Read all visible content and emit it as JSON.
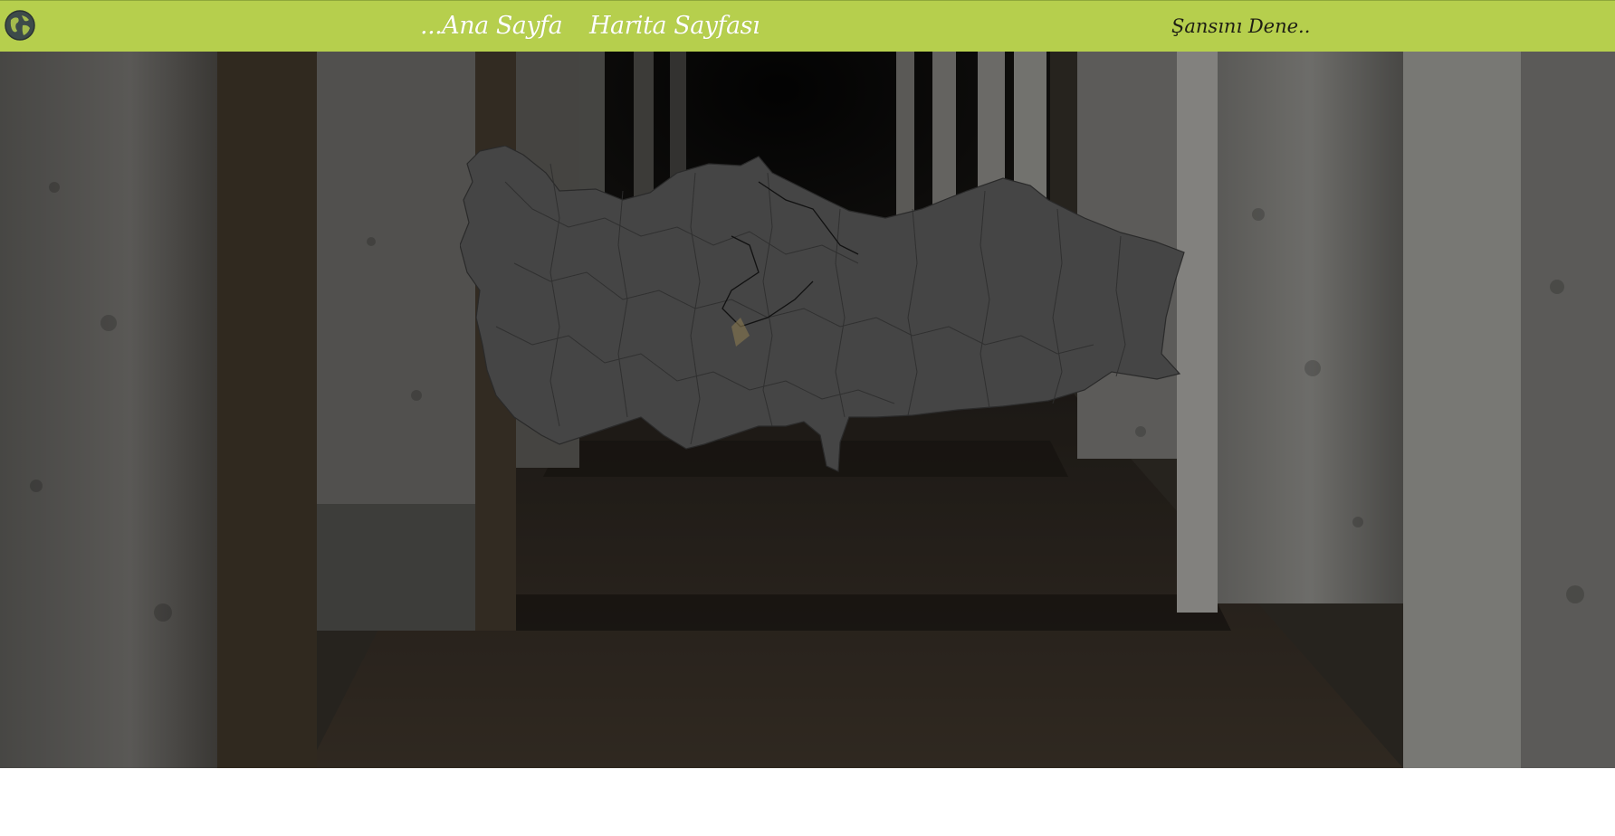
{
  "nav": {
    "logo_icon": "globe-icon",
    "home_label": "...Ana Sayfa",
    "map_label": "Harita Sayfası",
    "luck_label": "Şansını Dene.."
  },
  "colors": {
    "navbar_bg": "#b6cf4d",
    "nav_text": "#ffffff",
    "luck_text": "#1e1e14",
    "map_fill": "#454545",
    "map_stroke": "#2a2a2a"
  },
  "hero": {
    "background": "dark stone colonnade photograph",
    "map": "Turkey provinces map"
  }
}
